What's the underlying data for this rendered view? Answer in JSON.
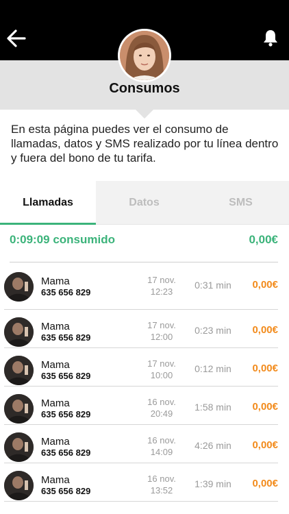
{
  "header": {
    "title": "Consumos",
    "back_icon": "arrow-left-icon",
    "bell_icon": "bell-icon"
  },
  "intro": {
    "text": "En esta página puedes ver el consumo de llamadas, datos y SMS realizado por tu línea dentro y fuera del bono de tu tarifa."
  },
  "tabs": [
    {
      "label": "Llamadas",
      "active": true
    },
    {
      "label": "Datos",
      "active": false
    },
    {
      "label": "SMS",
      "active": false
    }
  ],
  "summary": {
    "consumed": "0:09:09 consumido",
    "amount": "0,00€"
  },
  "calls": [
    {
      "name": "Mama",
      "phone": "635 656 829",
      "date": "17 nov.",
      "time": "12:23",
      "duration": "0:31 min",
      "price": "0,00€"
    },
    {
      "name": "Mama",
      "phone": "635 656 829",
      "date": "17 nov.",
      "time": "12:00",
      "duration": "0:23 min",
      "price": "0,00€"
    },
    {
      "name": "Mama",
      "phone": "635 656 829",
      "date": "17 nov.",
      "time": "10:00",
      "duration": "0:12 min",
      "price": "0,00€"
    },
    {
      "name": "Mama",
      "phone": "635 656 829",
      "date": "16 nov.",
      "time": "20:49",
      "duration": "1:58 min",
      "price": "0,00€"
    },
    {
      "name": "Mama",
      "phone": "635 656 829",
      "date": "16 nov.",
      "time": "14:09",
      "duration": "4:26 min",
      "price": "0,00€"
    },
    {
      "name": "Mama",
      "phone": "635 656 829",
      "date": "16 nov.",
      "time": "13:52",
      "duration": "1:39 min",
      "price": "0,00€"
    }
  ],
  "colors": {
    "accent_green": "#3bb37a",
    "price_orange": "#f28b1c",
    "topbar": "#000000",
    "header_gray": "#e3e3e3"
  }
}
